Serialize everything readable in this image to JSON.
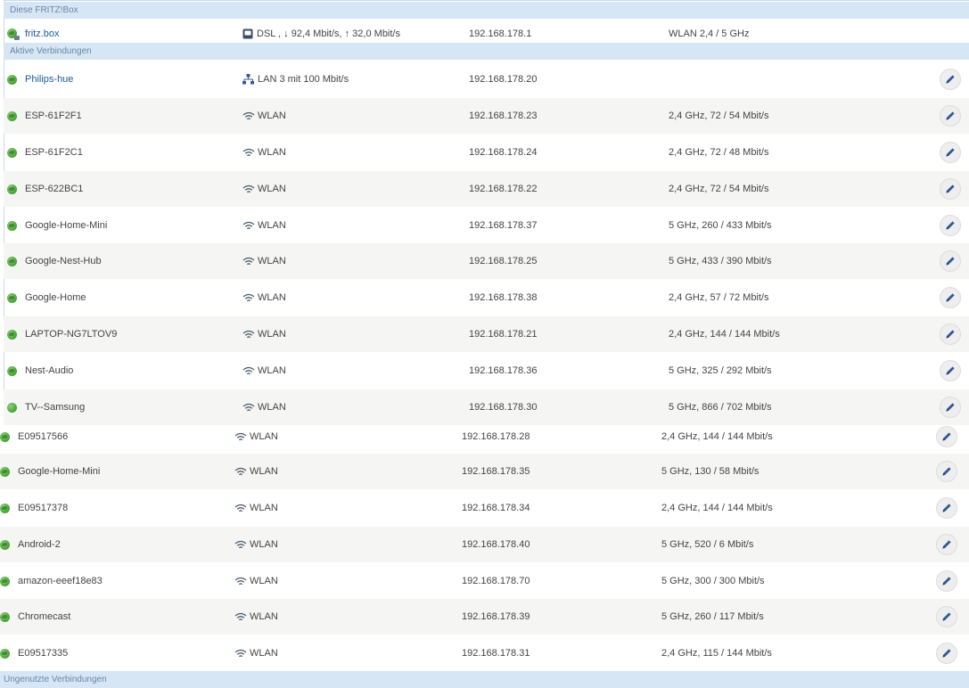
{
  "colors": {
    "section_bg": "#d6e6f5",
    "section_text": "#6a86a6",
    "link_text": "#1c5a9c",
    "online_icon": "#4fa83c",
    "alt_row_bg": "#f5f5f3"
  },
  "sections": {
    "this_box": "Diese FRITZ!Box",
    "active": "Aktive Verbindungen",
    "unused": "Ungenutzte Verbindungen"
  },
  "fritzbox": {
    "name": "fritz.box",
    "connection": "DSL , ↓ 92,4 Mbit/s, ↑ 32,0 Mbit/s",
    "ip": "192.168.178.1",
    "property": "WLAN 2,4 / 5 GHz",
    "icon": "router-globe-icon",
    "connection_icon": "dsl-icon"
  },
  "devices": [
    {
      "name": "Philips-hue",
      "connection": "LAN 3 mit 100 Mbit/s",
      "conn_type": "lan",
      "ip": "192.168.178.20",
      "property": "",
      "link": true
    },
    {
      "name": "ESP-61F2F1",
      "connection": "WLAN",
      "conn_type": "wlan",
      "ip": "192.168.178.23",
      "property": "2,4 GHz, 72 / 54 Mbit/s"
    },
    {
      "name": "ESP-61F2C1",
      "connection": "WLAN",
      "conn_type": "wlan",
      "ip": "192.168.178.24",
      "property": "2,4 GHz, 72 / 48 Mbit/s"
    },
    {
      "name": "ESP-622BC1",
      "connection": "WLAN",
      "conn_type": "wlan",
      "ip": "192.168.178.22",
      "property": "2,4 GHz, 72 / 54 Mbit/s"
    },
    {
      "name": "Google-Home-Mini",
      "connection": "WLAN",
      "conn_type": "wlan",
      "ip": "192.168.178.37",
      "property": "5 GHz, 260 / 433 Mbit/s"
    },
    {
      "name": "Google-Nest-Hub",
      "connection": "WLAN",
      "conn_type": "wlan",
      "ip": "192.168.178.25",
      "property": "5 GHz, 433 / 390 Mbit/s"
    },
    {
      "name": "Google-Home",
      "connection": "WLAN",
      "conn_type": "wlan",
      "ip": "192.168.178.38",
      "property": "2,4 GHz, 57 / 72 Mbit/s"
    },
    {
      "name": "LAPTOP-NG7LTOV9",
      "connection": "WLAN",
      "conn_type": "wlan",
      "ip": "192.168.178.21",
      "property": "2,4 GHz, 144 / 144 Mbit/s"
    },
    {
      "name": "Nest-Audio",
      "connection": "WLAN",
      "conn_type": "wlan",
      "ip": "192.168.178.36",
      "property": "5 GHz, 325 / 292 Mbit/s"
    },
    {
      "name": "TV--Samsung",
      "connection": "WLAN",
      "conn_type": "wlan",
      "ip": "192.168.178.30",
      "property": "5 GHz, 866 / 702 Mbit/s",
      "plain_icon": true
    },
    {
      "name": "E09517566",
      "connection": "WLAN",
      "conn_type": "wlan",
      "ip": "192.168.178.28",
      "property": "2,4 GHz, 144 / 144 Mbit/s"
    },
    {
      "name": "Google-Home-Mini",
      "connection": "WLAN",
      "conn_type": "wlan",
      "ip": "192.168.178.35",
      "property": "5 GHz, 130 / 58 Mbit/s"
    },
    {
      "name": "E09517378",
      "connection": "WLAN",
      "conn_type": "wlan",
      "ip": "192.168.178.34",
      "property": "2,4 GHz, 144 / 144 Mbit/s"
    },
    {
      "name": "Android-2",
      "connection": "WLAN",
      "conn_type": "wlan",
      "ip": "192.168.178.40",
      "property": "5 GHz, 520 / 6 Mbit/s"
    },
    {
      "name": "amazon-eeef18e83",
      "connection": "WLAN",
      "conn_type": "wlan",
      "ip": "192.168.178.70",
      "property": "5 GHz, 300 / 300 Mbit/s"
    },
    {
      "name": "Chromecast",
      "connection": "WLAN",
      "conn_type": "wlan",
      "ip": "192.168.178.39",
      "property": "5 GHz, 260 / 117 Mbit/s"
    },
    {
      "name": "E09517335",
      "connection": "WLAN",
      "conn_type": "wlan",
      "ip": "192.168.178.31",
      "property": "2,4 GHz, 115 / 144 Mbit/s"
    }
  ],
  "icons": {
    "device": "globe-icon",
    "wlan": "wifi-icon",
    "lan": "network-icon",
    "edit": "pencil-icon"
  }
}
